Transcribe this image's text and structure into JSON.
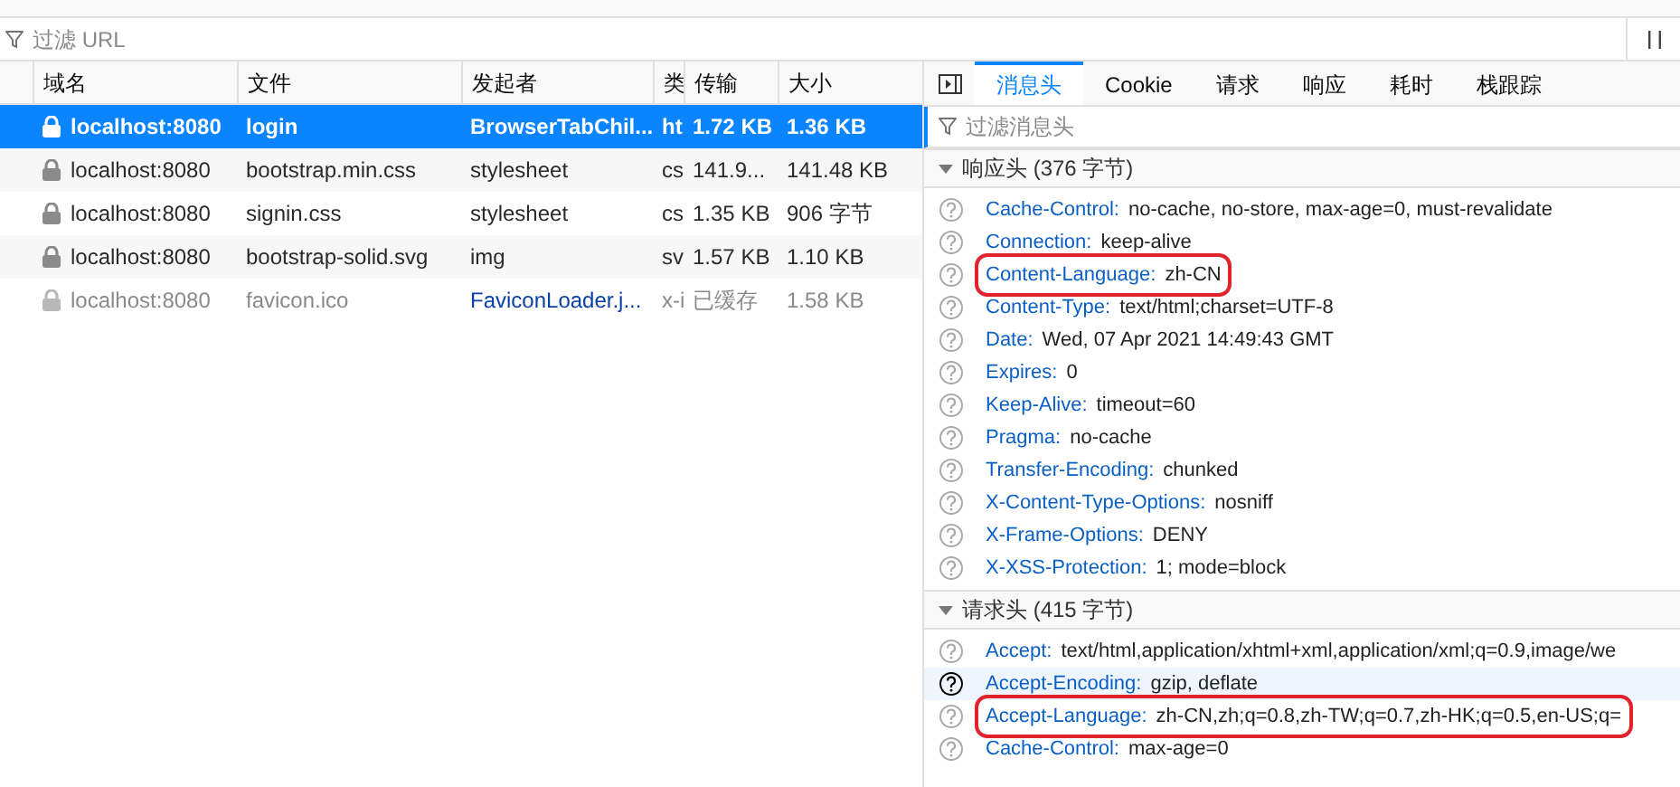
{
  "url_filter": {
    "placeholder": "过滤 URL"
  },
  "columns": [
    "域名",
    "文件",
    "发起者",
    "类",
    "传输",
    "大小"
  ],
  "requests": [
    {
      "domain": "localhost:8080",
      "file": "login",
      "initiator": "BrowserTabChil...",
      "initiator_link": false,
      "type": "ht",
      "transferred": "1.72 KB",
      "size": "1.36 KB",
      "selected": true,
      "cached": false
    },
    {
      "domain": "localhost:8080",
      "file": "bootstrap.min.css",
      "initiator": "stylesheet",
      "initiator_link": false,
      "type": "cs",
      "transferred": "141.9...",
      "size": "141.48 KB",
      "selected": false,
      "cached": false
    },
    {
      "domain": "localhost:8080",
      "file": "signin.css",
      "initiator": "stylesheet",
      "initiator_link": false,
      "type": "cs",
      "transferred": "1.35 KB",
      "size": "906 字节",
      "selected": false,
      "cached": false
    },
    {
      "domain": "localhost:8080",
      "file": "bootstrap-solid.svg",
      "initiator": "img",
      "initiator_link": false,
      "type": "sv",
      "transferred": "1.57 KB",
      "size": "1.10 KB",
      "selected": false,
      "cached": false
    },
    {
      "domain": "localhost:8080",
      "file": "favicon.ico",
      "initiator": "FaviconLoader.j...",
      "initiator_link": true,
      "type": "x-i",
      "transferred": "已缓存",
      "size": "1.58 KB",
      "selected": false,
      "cached": true
    }
  ],
  "detail_tabs": [
    {
      "label": "消息头",
      "selected": true
    },
    {
      "label": "Cookie",
      "selected": false
    },
    {
      "label": "请求",
      "selected": false
    },
    {
      "label": "响应",
      "selected": false
    },
    {
      "label": "耗时",
      "selected": false
    },
    {
      "label": "栈跟踪",
      "selected": false
    }
  ],
  "header_filter": {
    "placeholder": "过滤消息头"
  },
  "sections": [
    {
      "title": "响应头 (376 字节)",
      "expanded": true,
      "headers": [
        {
          "name": "Cache-Control:",
          "value": "no-cache, no-store, max-age=0, must-revalidate",
          "highlighted": false,
          "hovered": false
        },
        {
          "name": "Connection:",
          "value": "keep-alive",
          "highlighted": false,
          "hovered": false
        },
        {
          "name": "Content-Language:",
          "value": "zh-CN",
          "highlighted": true,
          "hovered": false
        },
        {
          "name": "Content-Type:",
          "value": "text/html;charset=UTF-8",
          "highlighted": false,
          "hovered": false
        },
        {
          "name": "Date:",
          "value": "Wed, 07 Apr 2021 14:49:43 GMT",
          "highlighted": false,
          "hovered": false
        },
        {
          "name": "Expires:",
          "value": "0",
          "highlighted": false,
          "hovered": false
        },
        {
          "name": "Keep-Alive:",
          "value": "timeout=60",
          "highlighted": false,
          "hovered": false
        },
        {
          "name": "Pragma:",
          "value": "no-cache",
          "highlighted": false,
          "hovered": false
        },
        {
          "name": "Transfer-Encoding:",
          "value": "chunked",
          "highlighted": false,
          "hovered": false
        },
        {
          "name": "X-Content-Type-Options:",
          "value": "nosniff",
          "highlighted": false,
          "hovered": false
        },
        {
          "name": "X-Frame-Options:",
          "value": "DENY",
          "highlighted": false,
          "hovered": false
        },
        {
          "name": "X-XSS-Protection:",
          "value": "1; mode=block",
          "highlighted": false,
          "hovered": false
        }
      ]
    },
    {
      "title": "请求头 (415 字节)",
      "expanded": true,
      "headers": [
        {
          "name": "Accept:",
          "value": "text/html,application/xhtml+xml,application/xml;q=0.9,image/we",
          "highlighted": false,
          "hovered": false
        },
        {
          "name": "Accept-Encoding:",
          "value": "gzip, deflate",
          "highlighted": false,
          "hovered": true
        },
        {
          "name": "Accept-Language:",
          "value": "zh-CN,zh;q=0.8,zh-TW;q=0.7,zh-HK;q=0.5,en-US;q=",
          "highlighted": true,
          "hovered": false
        },
        {
          "name": "Cache-Control:",
          "value": "max-age=0",
          "highlighted": false,
          "hovered": false
        }
      ]
    }
  ]
}
